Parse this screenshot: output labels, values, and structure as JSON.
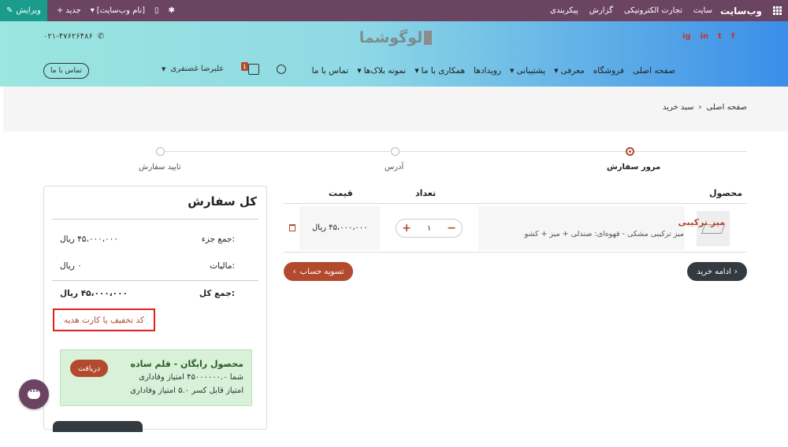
{
  "adminbar": {
    "brand": "وب‌سایت",
    "menu": [
      "سایت",
      "تجارت الکترونیکی",
      "گزارش",
      "پیکربندی"
    ],
    "edit_label": "ویرایش",
    "new_label": "جدید",
    "site_name_label": "[نام وب‌سایت]"
  },
  "header": {
    "phone": "۰۲۱-۴۷۶۲۶۴۸۶",
    "logo": "لوگوشما",
    "social": [
      "f",
      "t",
      "in",
      "ig"
    ],
    "contact_button": "تماس با ما",
    "nav": [
      "صفحه اصلی",
      "فروشگاه",
      "معرفی",
      "پشتیبانی",
      "رویدادها",
      "همکاری با ما",
      "نمونه بلاک‌ها",
      "تماس با ما"
    ],
    "cart_count": "1",
    "user_name": "علیرضا غضنفری"
  },
  "breadcrumb": {
    "home": "صفحه اصلی",
    "current": "سبد خرید"
  },
  "steps": [
    "مرور سفارش",
    "آدرس",
    "تایید سفارش"
  ],
  "table": {
    "headers": {
      "product": "محصول",
      "qty": "تعداد",
      "price": "قیمت"
    },
    "rows": [
      {
        "name": "میز ترکیبی",
        "desc": "میز ترکیبی مشکی - قهوه‌ای: صندلی + میز + کشو",
        "qty": "۱",
        "price": "۴۵،۰۰۰،۰۰۰ ریال"
      }
    ]
  },
  "buttons": {
    "checkout": "تسویه حساب",
    "continue": "ادامه خرید"
  },
  "summary": {
    "title": "کل سفارش",
    "subtotal_label": "جمع جزء:",
    "subtotal": "۴۵،۰۰۰،۰۰۰ ریال",
    "tax_label": "مالیات:",
    "tax": "۰ ریال",
    "total_label": "جمع کل:",
    "total": "۴۵،۰۰۰،۰۰۰ ریال",
    "coupon": "کد تخفیف یا کارت هدیه",
    "reward": {
      "title": "محصول رایگان - قلم ساده",
      "line1": "شما ۴۵۰۰۰۰۰۰.۰ امتیاز وفاداری",
      "line2": "امتیاز قابل کسر ۵.۰ امتیاز وفاداری",
      "button": "دریافت"
    }
  },
  "colors": {
    "accent": "#b24a2e",
    "adminbar": "#6b4462",
    "edit": "#1a9c8d"
  }
}
